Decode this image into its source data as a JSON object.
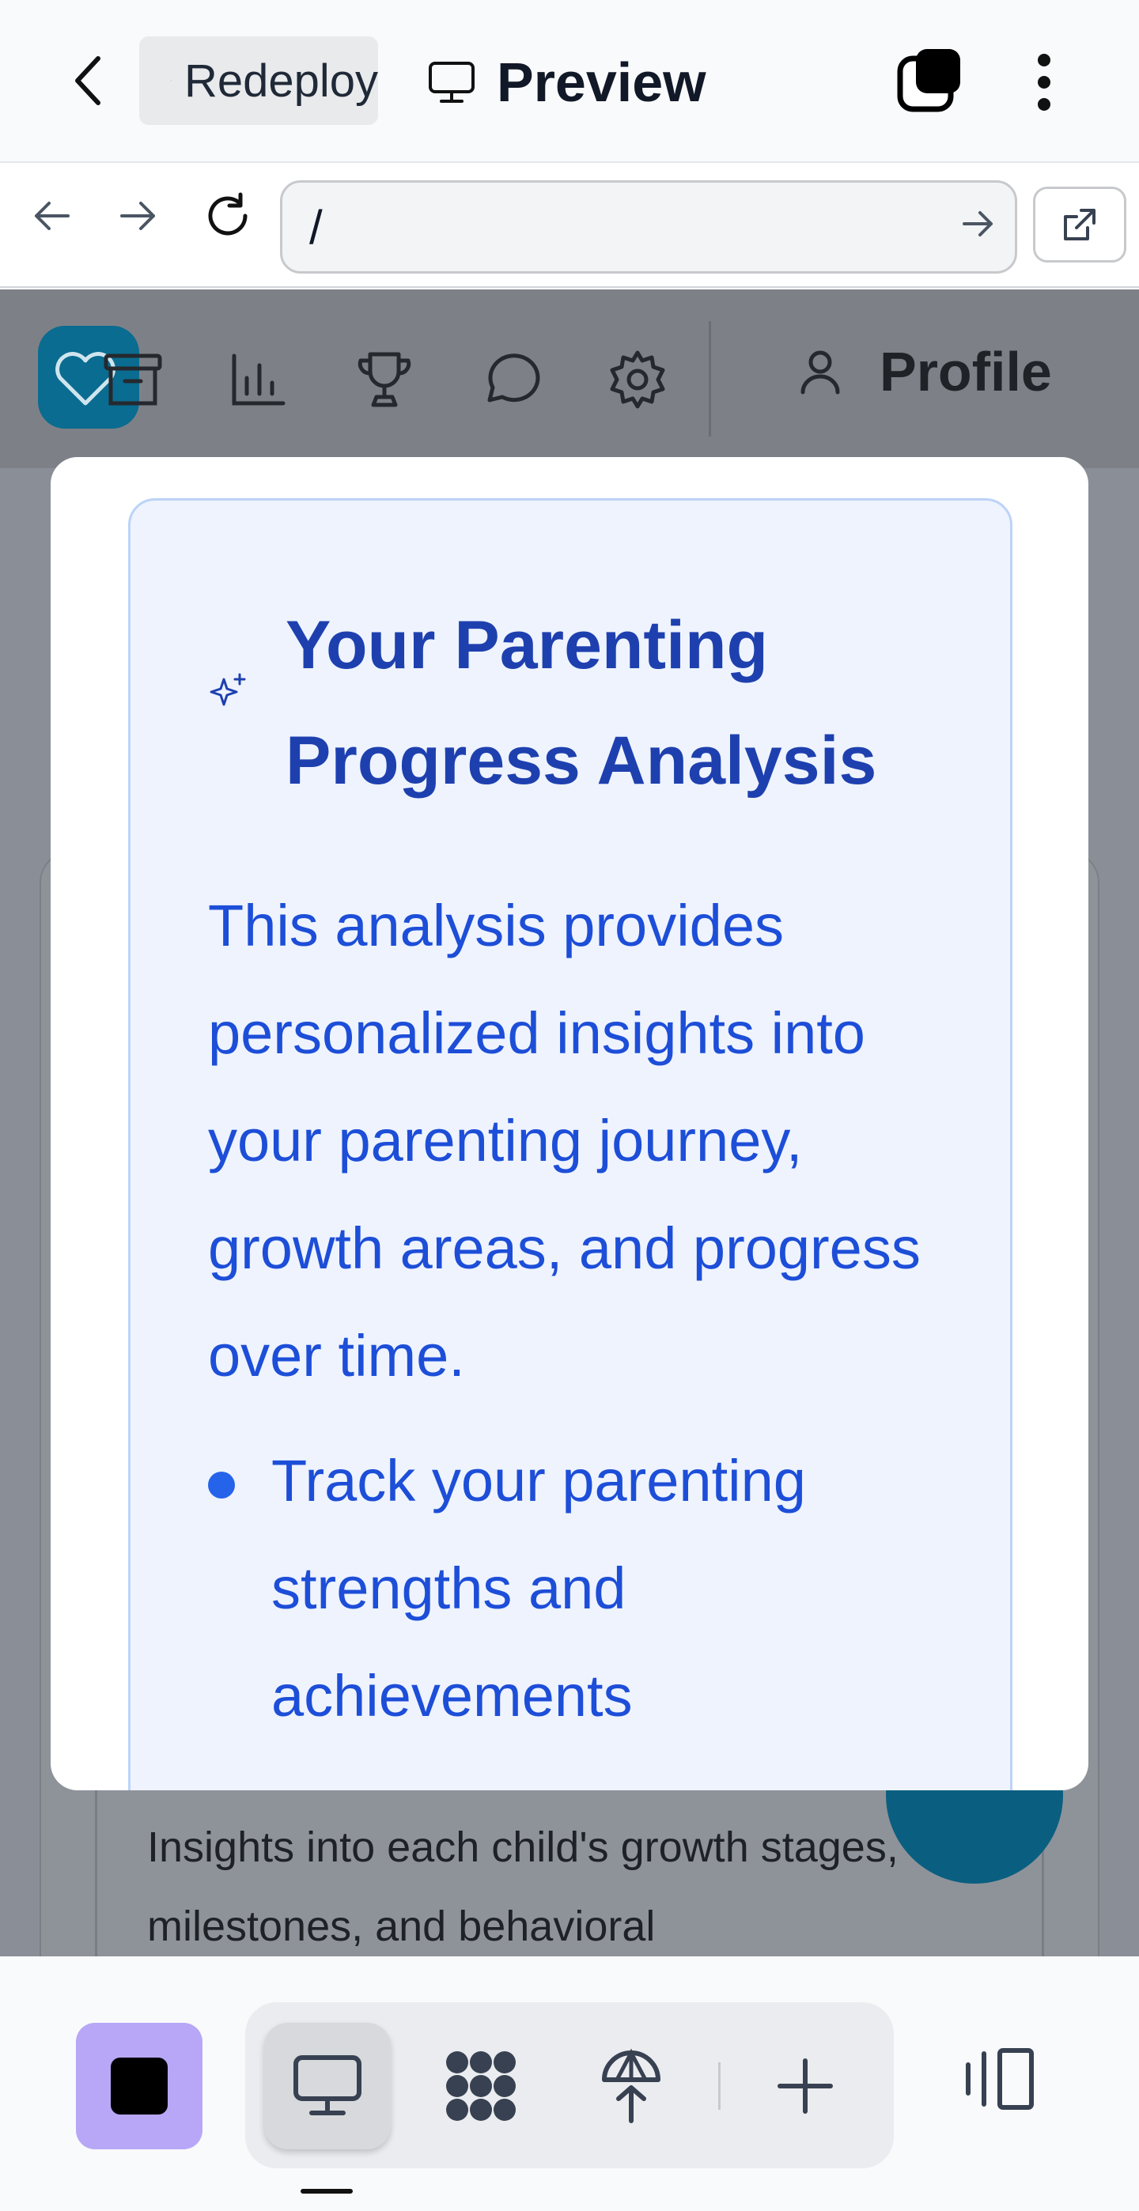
{
  "appbar": {
    "project_chip_label": "Redeploy",
    "preview_label": "Preview"
  },
  "browser": {
    "url": "/"
  },
  "app_nav": {
    "profile_label": "Profile",
    "accent_color": "#0a6c90"
  },
  "modal": {
    "title": "Your Parenting Progress Analysis",
    "description": "This analysis provides personalized insights into your parenting journey, growth areas, and progress over time.",
    "bullets": [
      "Track your parenting strengths and achievements"
    ],
    "title_color": "#1e40af",
    "text_color": "#1d4ed8",
    "card_bg": "#eef3fe"
  },
  "background_card": {
    "text": "Insights into each child's growth stages, milestones, and behavioral"
  },
  "bottombar": {
    "stop_color": "#b8a7f7"
  }
}
